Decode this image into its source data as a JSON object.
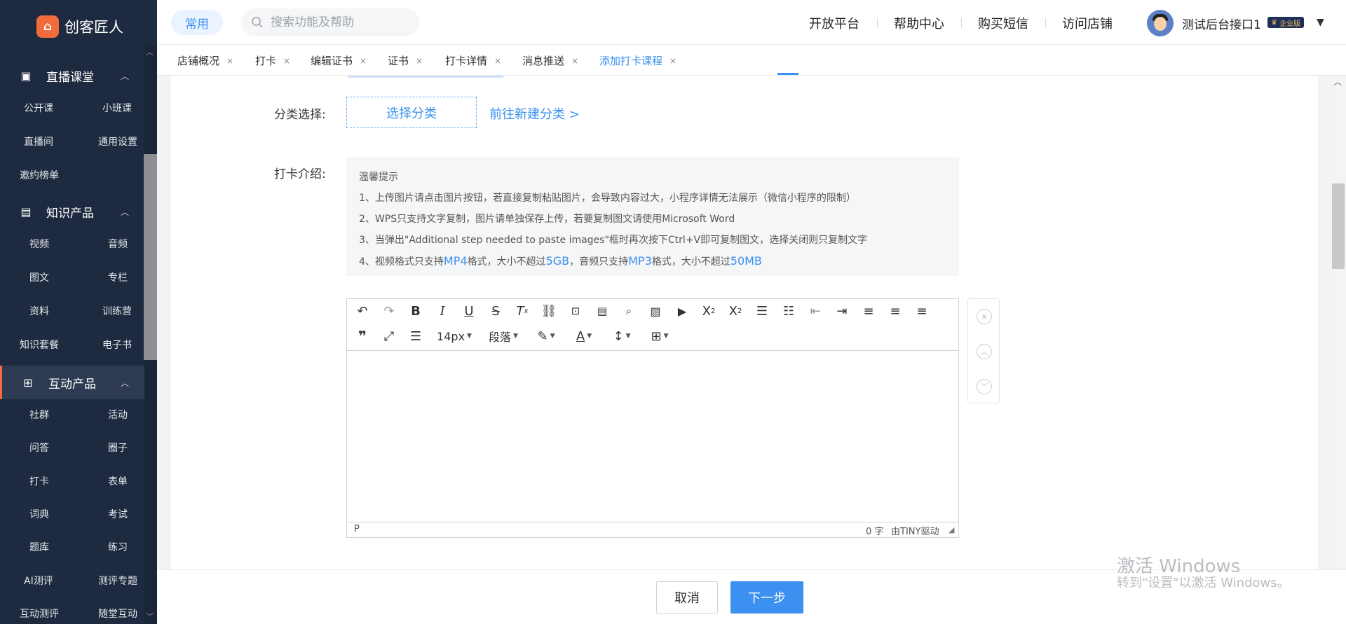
{
  "brand": {
    "name": "创客匠人",
    "logo_glyph": "⌂"
  },
  "sidebar": {
    "sections": [
      {
        "label": "直播课堂",
        "icon": "video-icon",
        "glyph": "▣",
        "items": [
          "公开课",
          "小班课",
          "直播间",
          "通用设置",
          "邀约榜单"
        ]
      },
      {
        "label": "知识产品",
        "icon": "book-icon",
        "glyph": "▤",
        "items": [
          "视频",
          "音频",
          "图文",
          "专栏",
          "资料",
          "训练营",
          "知识套餐",
          "电子书"
        ]
      },
      {
        "label": "互动产品",
        "icon": "grid-icon",
        "glyph": "⊞",
        "items": [
          "社群",
          "活动",
          "问答",
          "圈子",
          "打卡",
          "表单",
          "词典",
          "考试",
          "题库",
          "练习",
          "AI测评",
          "测评专题",
          "互动测评",
          "随堂互动"
        ]
      }
    ]
  },
  "topbar": {
    "common_label": "常用",
    "search": {
      "placeholder": "搜索功能及帮助"
    },
    "links": [
      "开放平台",
      "帮助中心",
      "购买短信",
      "访问店铺"
    ],
    "user": {
      "name": "测试后台接口1",
      "badge": "企业版"
    }
  },
  "tabs": [
    {
      "label": "店铺概况"
    },
    {
      "label": "打卡"
    },
    {
      "label": "编辑证书"
    },
    {
      "label": "证书"
    },
    {
      "label": "打卡详情"
    },
    {
      "label": "消息推送"
    },
    {
      "label": "添加打卡课程",
      "active": true
    }
  ],
  "form": {
    "category_label": "分类选择:",
    "category_button": "选择分类",
    "category_link": "前往新建分类 >",
    "intro_label": "打卡介绍:"
  },
  "tips": {
    "title": "温馨提示",
    "line1": "1、上传图片请点击图片按钮，若直接复制粘贴图片，会导致内容过大，小程序详情无法展示（微信小程序的限制）",
    "line2": "2、WPS只支持文字复制，图片请单独保存上传，若要复制图文请使用Microsoft Word",
    "line3": "3、当弹出\"Additional step needed to paste images\"框时再次按下Ctrl+V即可复制图文，选择关闭则只复制文字",
    "line4": {
      "a": "4、视频格式只支持",
      "b": "MP4",
      "c": "格式，大小不超过",
      "d": "5GB",
      "e": "，音频只支持",
      "f": "MP3",
      "g": "格式，大小不超过",
      "h": "50MB"
    }
  },
  "editor": {
    "font_size": "14px",
    "block_format": "段落",
    "status_path": "P",
    "word_count": "0 字",
    "powered": "由TINY驱动"
  },
  "footer": {
    "cancel": "取消",
    "next": "下一步"
  },
  "watermark": {
    "line1": "激活 Windows",
    "line2": "转到\"设置\"以激活 Windows。"
  },
  "colors": {
    "accent": "#3b90f0",
    "sidebar_bg": "#1e2a3f",
    "brand": "#f26b3a"
  }
}
